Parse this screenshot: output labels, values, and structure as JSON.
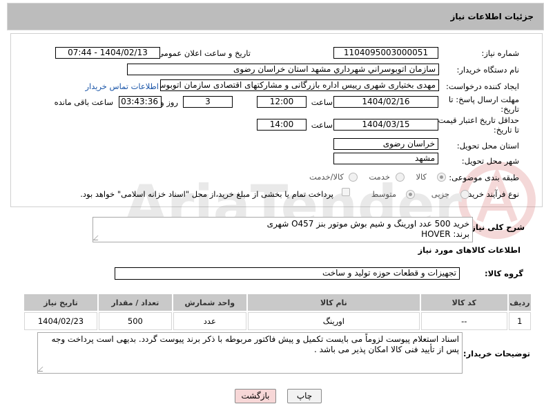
{
  "header": {
    "title": "جزئیات اطلاعات نیاز"
  },
  "form": {
    "need_number_label": "شماره نیاز:",
    "need_number": "1104095003000051",
    "announce_label": "تاریخ و ساعت اعلان عمومی:",
    "announce_value": "1404/02/13 - 07:44",
    "buyer_label": "نام دستگاه خریدار:",
    "buyer_value": "سازمان اتوبوسراني شهرداري مشهد استان خراسان رضوی",
    "creator_label": "ایجاد کننده درخواست:",
    "creator_value": "مهدی بختیاری شهری رییس اداره بازرگانی و مشارکتهای اقتصادی سازمان اتوبوسرانی",
    "buyer_contact_link": "اطلاعات تماس خریدار",
    "deadline_label1": "مهلت ارسال پاسخ: تا",
    "deadline_label2": "تاریخ:",
    "deadline_date": "1404/02/16",
    "time_label": "ساعت",
    "deadline_time": "12:00",
    "days_value": "3",
    "days_label": "روز و",
    "remaining_value": "03:43:36",
    "remaining_label": "ساعت باقی مانده",
    "validity_label1": "حداقل تاریخ اعتبار قیمت:",
    "validity_label2": "تا تاریخ:",
    "validity_date": "1404/03/15",
    "validity_time": "14:00",
    "province_label": "استان محل تحویل:",
    "province_value": "خراسان رضوی",
    "city_label": "شهر محل تحویل:",
    "city_value": "مشهد",
    "category_label": "طبقه بندی موضوعی:",
    "category_options": [
      "کالا",
      "خدمت",
      "کالا/خدمت"
    ],
    "process_label": "نوع فرآیند خرید :",
    "process_options": [
      "جزیی",
      "متوسط"
    ],
    "process_note": "پرداخت تمام یا بخشی از مبلغ خرید،از محل \"اسناد خزانه اسلامی\" خواهد بود."
  },
  "description": {
    "label": "شرح کلی نیاز:",
    "line1": "خرید 500 عدد اورینگ و شیم بوش موتور بنز O457 شهری",
    "line2": "برند: HOVER"
  },
  "goods_info": {
    "title": "اطلاعات کالاهای مورد نیاز",
    "group_label": "گروه کالا:",
    "group_value": "تجهیزات و قطعات حوزه تولید و ساخت"
  },
  "table": {
    "headers": [
      "ردیف",
      "کد کالا",
      "نام کالا",
      "واحد شمارش",
      "تعداد / مقدار",
      "تاریخ نیاز"
    ],
    "rows": [
      [
        "1",
        "--",
        "اورینگ",
        "عدد",
        "500",
        "1404/02/23"
      ]
    ]
  },
  "buyer_notes": {
    "label": "توضیحات خریدار:",
    "text": "اسناد استعلام پیوست لزوماً می بایست تکمیل و پیش فاکتور مربوطه با ذکر برند پیوست گردد. بدیهی است پرداخت وجه پس از تأیید فنی کالا امکان پذیر می باشد ."
  },
  "buttons": {
    "print": "چاپ",
    "back": "بازگشت"
  },
  "colors": {
    "header_bg": "#bcbcbc",
    "link": "#1a55a8",
    "back_button_bg": "#f7d7d7"
  }
}
